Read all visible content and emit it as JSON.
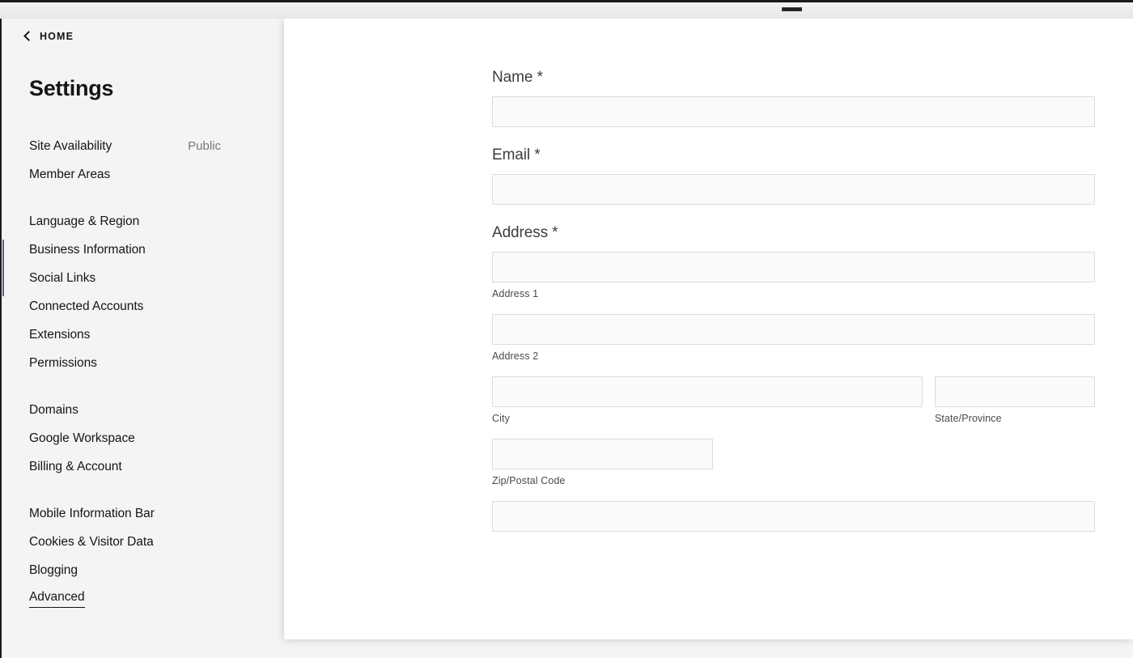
{
  "window": {
    "drag_handle_name": "window-drag-handle"
  },
  "sidebar": {
    "breadcrumb": {
      "icon": "chevron-left-icon",
      "label": "HOME"
    },
    "title": "Settings",
    "groups": [
      {
        "items": [
          {
            "label": "Site Availability",
            "value": "Public",
            "active": false
          },
          {
            "label": "Member Areas",
            "value": "",
            "active": false
          }
        ]
      },
      {
        "items": [
          {
            "label": "Language & Region",
            "value": "",
            "active": false
          },
          {
            "label": "Business Information",
            "value": "",
            "active": false
          },
          {
            "label": "Social Links",
            "value": "",
            "active": false
          },
          {
            "label": "Connected Accounts",
            "value": "",
            "active": false
          },
          {
            "label": "Extensions",
            "value": "",
            "active": false
          },
          {
            "label": "Permissions",
            "value": "",
            "active": false
          }
        ]
      },
      {
        "items": [
          {
            "label": "Domains",
            "value": "",
            "active": false
          },
          {
            "label": "Google Workspace",
            "value": "",
            "active": false
          },
          {
            "label": "Billing & Account",
            "value": "",
            "active": false
          }
        ]
      },
      {
        "items": [
          {
            "label": "Mobile Information Bar",
            "value": "",
            "active": false
          },
          {
            "label": "Cookies & Visitor Data",
            "value": "",
            "active": false
          },
          {
            "label": "Blogging",
            "value": "",
            "active": false
          },
          {
            "label": "Advanced",
            "value": "",
            "active": true
          }
        ]
      }
    ]
  },
  "form": {
    "name": {
      "label": "Name *",
      "value": "",
      "placeholder": ""
    },
    "email": {
      "label": "Email *",
      "value": "",
      "placeholder": ""
    },
    "address": {
      "label": "Address *",
      "line1": {
        "value": "",
        "placeholder": "",
        "caption": "Address 1"
      },
      "line2": {
        "value": "",
        "placeholder": "",
        "caption": "Address 2"
      },
      "city": {
        "value": "",
        "placeholder": "",
        "caption": "City"
      },
      "state": {
        "value": "",
        "placeholder": "",
        "caption": "State/Province"
      },
      "zip": {
        "value": "",
        "placeholder": "",
        "caption": "Zip/Postal Code"
      },
      "extra": {
        "value": "",
        "placeholder": ""
      }
    }
  },
  "colors": {
    "page_background": "#f4f4f4",
    "panel_background": "#ffffff",
    "text_primary": "#151515",
    "text_muted": "#787878",
    "input_fill": "#fafafa",
    "input_border": "#dcdcdc",
    "chrome_dark": "#1b1b1b",
    "accent": "#2c2f52"
  }
}
